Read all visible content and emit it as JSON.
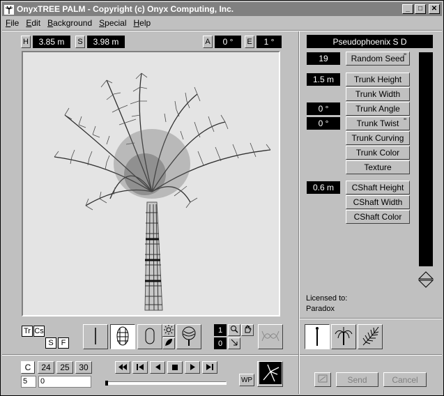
{
  "window": {
    "title": "OnyxTREE PALM - Copyright (c) Onyx Computing, Inc.",
    "minimize_label": "_",
    "maximize_label": "□",
    "close_label": "✕"
  },
  "menu": [
    "File",
    "Edit",
    "Background",
    "Special",
    "Help"
  ],
  "dimensions": {
    "h_label": "H",
    "h_value": "3.85 m",
    "s_label": "S",
    "s_value": "3.98 m",
    "a_label": "A",
    "a_value": "0 °",
    "e_label": "E",
    "e_value": "1 °"
  },
  "species": "Pseudophoenix S D",
  "params": {
    "random_seed_value": "19",
    "random_seed_label": "Random Seed",
    "trunk_height_value": "1.5 m",
    "trunk_height_label": "Trunk Height",
    "trunk_width_label": "Trunk Width",
    "trunk_angle_value": "0 °",
    "trunk_angle_label": "Trunk Angle",
    "trunk_twist_value": "0 °",
    "trunk_twist_label": "Trunk Twist",
    "trunk_curving_label": "Trunk Curving",
    "trunk_color_label": "Trunk Color",
    "texture_label": "Texture",
    "cshaft_height_value": "0.6 m",
    "cshaft_height_label": "CShaft Height",
    "cshaft_width_label": "CShaft Width",
    "cshaft_color_label": "CShaft Color",
    "mark": "\""
  },
  "license": {
    "licensed_to_label": "Licensed to:",
    "licensee": "Paradox"
  },
  "render_toggles": {
    "tr": "Tr",
    "cs": "Cs",
    "s": "S",
    "f": "F"
  },
  "zoom": {
    "top": "1",
    "bottom": "0"
  },
  "frames": {
    "c": "C",
    "f24": "24",
    "f25": "25",
    "f30": "30",
    "frame_value": "5",
    "frame_field": "0"
  },
  "wp_label": "WP",
  "footer": {
    "send": "Send",
    "cancel": "Cancel"
  },
  "icons": {
    "app": "palm-icon",
    "playback": [
      "skip-start-icon",
      "step-back-icon",
      "play-back-icon",
      "stop-icon",
      "play-icon",
      "step-forward-icon"
    ]
  }
}
